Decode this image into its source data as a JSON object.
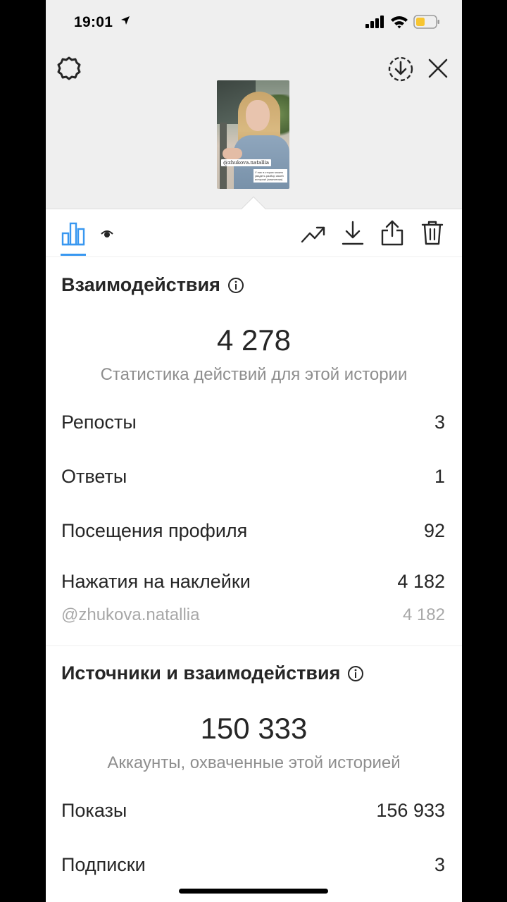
{
  "status_bar": {
    "time": "19:01"
  },
  "story": {
    "sticker_mention": "@zhukova.natallia",
    "note_text": "У нас в сторис можно увидеть разбор своей истории! (аналитика)"
  },
  "tabs": [
    {
      "name": "insights",
      "icon": "bar-chart-icon",
      "selected": true
    },
    {
      "name": "viewers",
      "icon": "eye-icon",
      "selected": false
    }
  ],
  "actions": [
    {
      "name": "promote",
      "icon": "trending-up-icon"
    },
    {
      "name": "save",
      "icon": "download-icon"
    },
    {
      "name": "share",
      "icon": "share-icon"
    },
    {
      "name": "delete",
      "icon": "trash-icon"
    }
  ],
  "interactions": {
    "title": "Взаимодействия",
    "total": "4 278",
    "caption": "Статистика действий для этой истории",
    "rows": [
      {
        "label": "Репосты",
        "value": "3"
      },
      {
        "label": "Ответы",
        "value": "1"
      },
      {
        "label": "Посещения профиля",
        "value": "92"
      },
      {
        "label": "Нажатия на наклейки",
        "value": "4 182"
      }
    ],
    "sub_row": {
      "label": "@zhukova.natallia",
      "value": "4 182"
    }
  },
  "discovery": {
    "title": "Источники и взаимодействия",
    "total": "150 333",
    "caption": "Аккаунты, охваченные этой историей",
    "rows": [
      {
        "label": "Показы",
        "value": "156 933"
      },
      {
        "label": "Подписки",
        "value": "3"
      }
    ]
  },
  "colors": {
    "accent": "#3897f0",
    "text": "#262626",
    "secondary": "#8e8e8e",
    "top_bg": "#efefef"
  }
}
